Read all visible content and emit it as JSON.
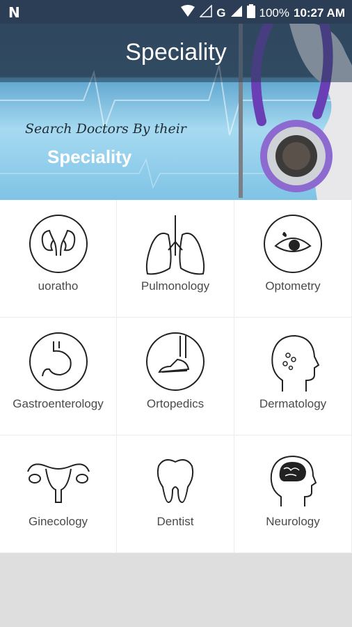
{
  "status_bar": {
    "left_icon": "N",
    "signal_label": "G",
    "battery": "100%",
    "time": "10:27 AM"
  },
  "header": {
    "title": "Speciality",
    "banner_line1": "Search Doctors By their",
    "banner_line2": "Speciality"
  },
  "specialities": [
    {
      "label": "uoratho",
      "icon": "kidney-icon"
    },
    {
      "label": "Pulmonology",
      "icon": "lungs-icon"
    },
    {
      "label": "Optometry",
      "icon": "eye-icon"
    },
    {
      "label": "Gastroenterology",
      "icon": "stomach-icon"
    },
    {
      "label": "Ortopedics",
      "icon": "foot-bone-icon"
    },
    {
      "label": "Dermatology",
      "icon": "head-skin-icon"
    },
    {
      "label": "Ginecology",
      "icon": "uterus-icon"
    },
    {
      "label": "Dentist",
      "icon": "tooth-icon"
    },
    {
      "label": "Neurology",
      "icon": "brain-icon"
    }
  ]
}
